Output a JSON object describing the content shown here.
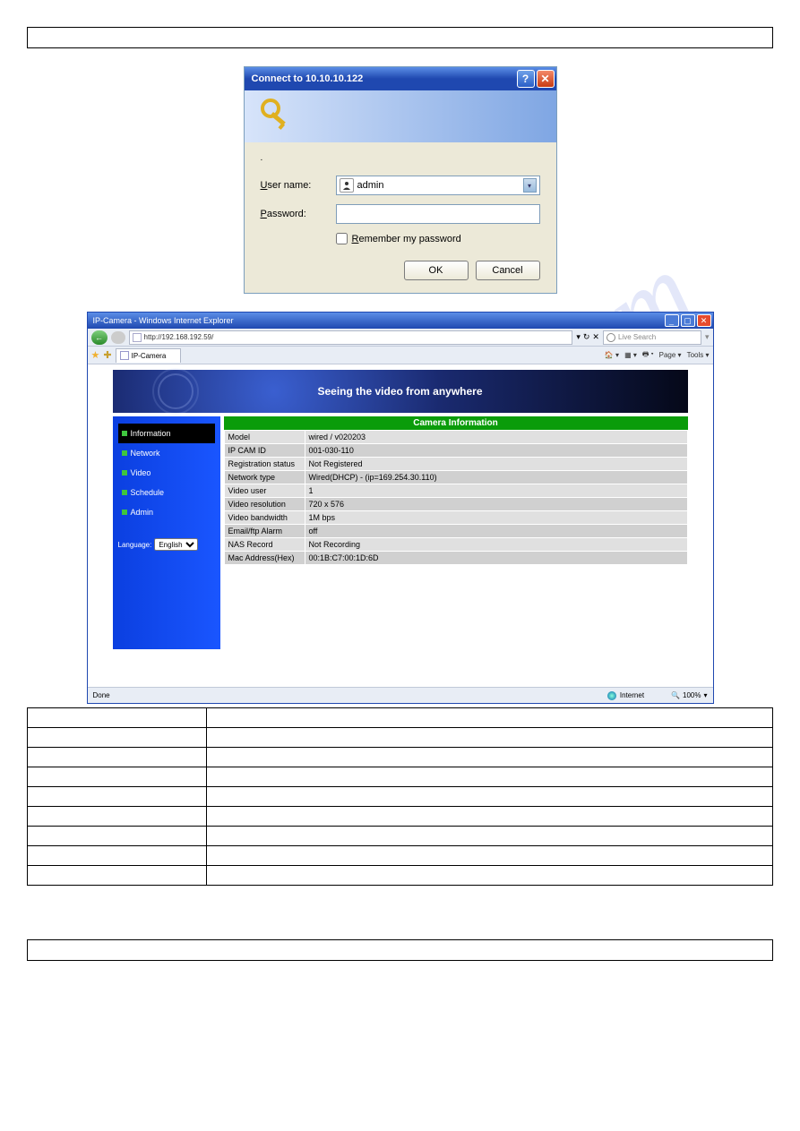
{
  "login": {
    "title": "Connect to 10.10.10.122",
    "user_label_u": "U",
    "user_label_rest": "ser name:",
    "pass_label_u": "P",
    "pass_label_rest": "assword:",
    "username_value": "admin",
    "remember_u": "R",
    "remember_rest": "emember my password",
    "ok": "OK",
    "cancel": "Cancel",
    "help_glyph": "?",
    "close_glyph": "✕"
  },
  "ie": {
    "window_title": "IP-Camera - Windows Internet Explorer",
    "address": "http://192.168.192.59/",
    "search_placeholder": "Live Search",
    "tab_label": "IP-Camera",
    "tools": {
      "page": "Page",
      "tools": "Tools"
    },
    "hero": "Seeing the video from anywhere",
    "sidebar": {
      "items": [
        "Information",
        "Network",
        "Video",
        "Schedule",
        "Admin"
      ],
      "lang_label": "Language:",
      "lang_value": "English"
    },
    "info_header": "Camera Information",
    "rows": [
      {
        "k": "Model",
        "v": "wired / v020203"
      },
      {
        "k": "IP CAM ID",
        "v": "001-030-110"
      },
      {
        "k": "Registration status",
        "v": "Not Registered"
      },
      {
        "k": "Network type",
        "v": "Wired(DHCP) - (ip=169.254.30.110)"
      },
      {
        "k": "Video user",
        "v": "1"
      },
      {
        "k": "Video resolution",
        "v": "720 x 576"
      },
      {
        "k": "Video bandwidth",
        "v": "1M bps"
      },
      {
        "k": "Email/ftp Alarm",
        "v": "off"
      },
      {
        "k": "NAS Record",
        "v": "Not Recording"
      },
      {
        "k": "Mac Address(Hex)",
        "v": "00:1B:C7:00:1D:6D"
      }
    ],
    "status": {
      "done": "Done",
      "zone": "Internet",
      "zoom": "100%"
    },
    "min": "_",
    "max": "▢",
    "close": "✕",
    "back": "←",
    "go": "→",
    "refresh": "↻",
    "dd": "▾"
  },
  "lower_rows": 9,
  "watermark": "manualslib.com"
}
